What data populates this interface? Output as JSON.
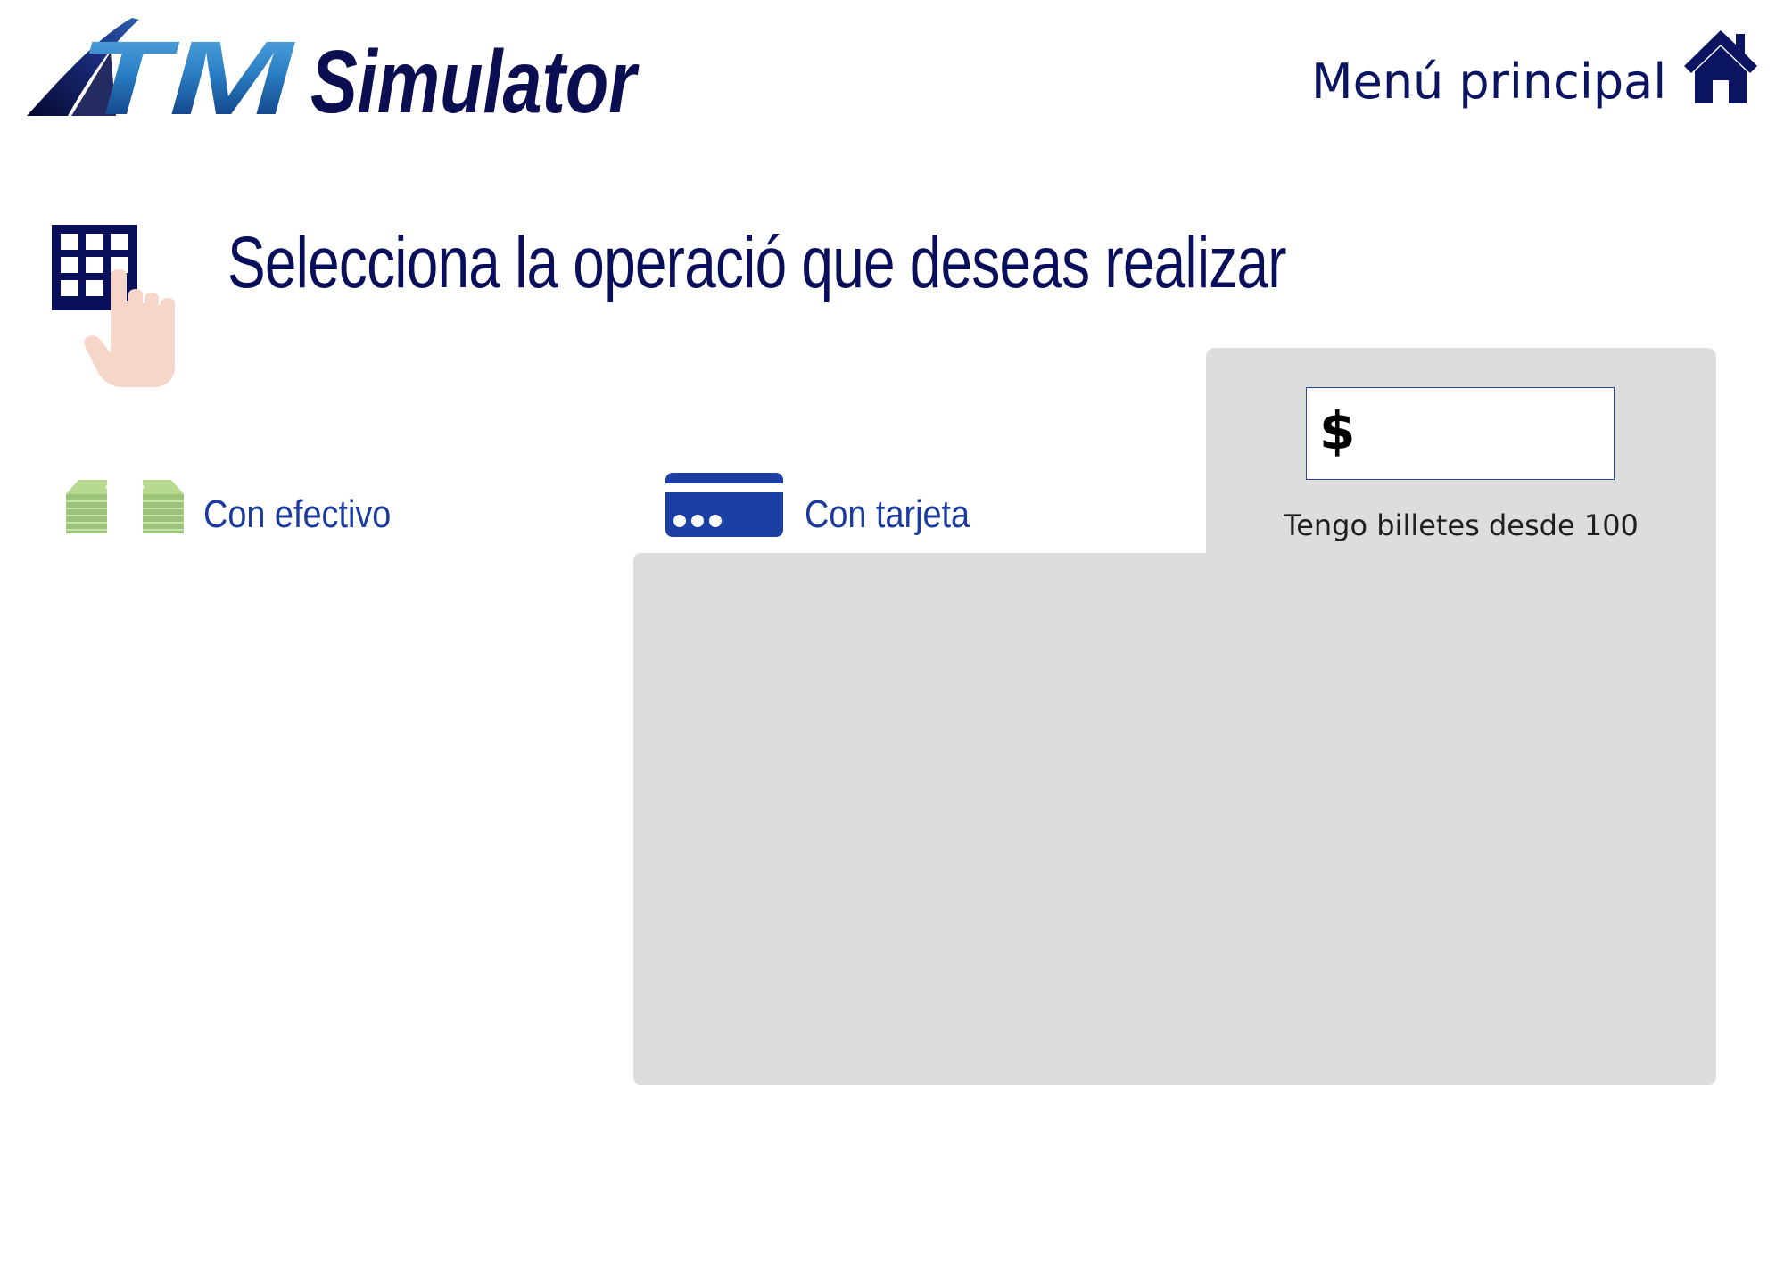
{
  "header": {
    "logo_text": "ATM Simulator",
    "home_label": "Menú principal"
  },
  "icons": {
    "logo": "atm-simulator-logo",
    "home": "home-icon",
    "keypad": "keypad-hand-icon",
    "cash": "cash-stack-icon",
    "card": "credit-card-icon"
  },
  "main": {
    "title": "Selecciona la operació que deseas realizar",
    "options": [
      {
        "label": "Con efectivo"
      },
      {
        "label": "Con tarjeta"
      }
    ]
  },
  "panel": {
    "currency_symbol": "$",
    "amount_value": "",
    "hint": "Tengo billetes desde 100"
  },
  "colors": {
    "brand_navy": "#0a0f5c",
    "link_blue": "#1a3a9e",
    "card_blue": "#1b3fa3",
    "cash_green": "#9cc47a",
    "panel_grey": "#dddddd"
  }
}
